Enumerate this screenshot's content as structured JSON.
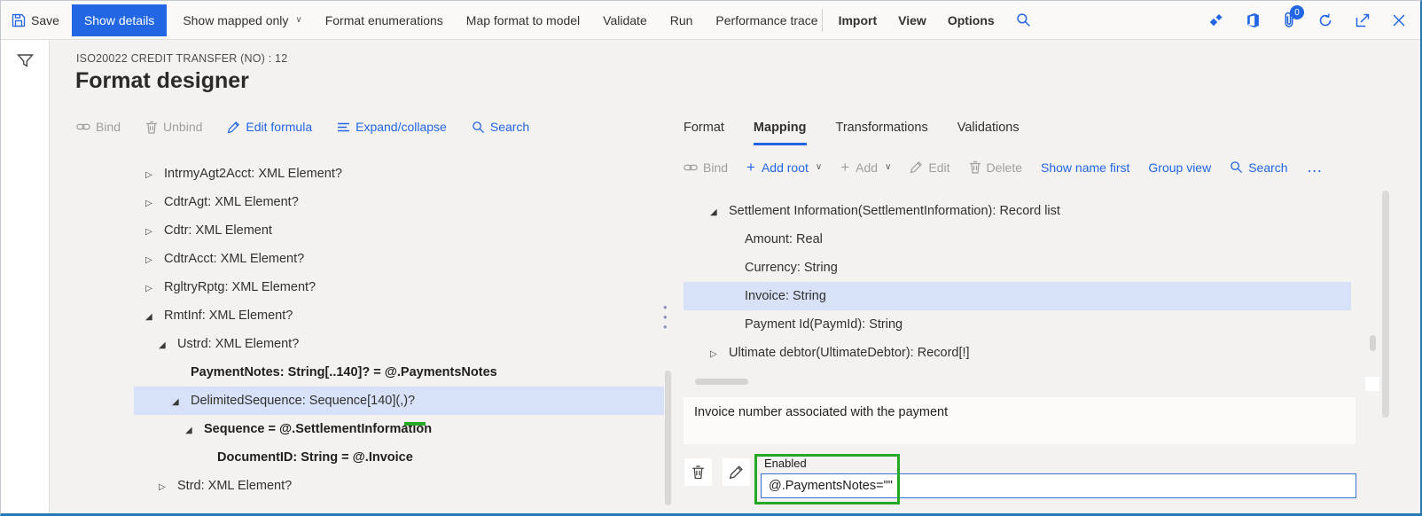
{
  "topbar": {
    "save": "Save",
    "show_details": "Show details",
    "show_mapped_only": "Show mapped only",
    "format_enumerations": "Format enumerations",
    "map_format_to_model": "Map format to model",
    "validate": "Validate",
    "run": "Run",
    "performance_trace": "Performance trace",
    "import": "Import",
    "view": "View",
    "options": "Options",
    "attachments_badge": "0"
  },
  "header": {
    "record_caption": "ISO20022 CREDIT TRANSFER (NO) : 12",
    "page_title": "Format designer"
  },
  "left_panel": {
    "toolbar": {
      "bind": "Bind",
      "unbind": "Unbind",
      "edit_formula": "Edit formula",
      "expand_collapse": "Expand/collapse",
      "search": "Search"
    },
    "tree": [
      {
        "label": "IntrmyAgt2Acct: XML Element?",
        "indent": 0,
        "arrow": "collapsed"
      },
      {
        "label": "CdtrAgt: XML Element?",
        "indent": 0,
        "arrow": "collapsed"
      },
      {
        "label": "Cdtr: XML Element",
        "indent": 0,
        "arrow": "collapsed"
      },
      {
        "label": "CdtrAcct: XML Element?",
        "indent": 0,
        "arrow": "collapsed"
      },
      {
        "label": "RgltryRptg: XML Element?",
        "indent": 0,
        "arrow": "collapsed"
      },
      {
        "label": "RmtInf: XML Element?",
        "indent": 0,
        "arrow": "expanded"
      },
      {
        "label": "Ustrd: XML Element?",
        "indent": 1,
        "arrow": "expanded"
      },
      {
        "label": "PaymentNotes: String[..140]? = @.PaymentsNotes",
        "indent": 2,
        "bold": true
      },
      {
        "label": "DelimitedSequence: Sequence[140](,)?",
        "indent": 2,
        "arrow": "expanded",
        "selected": true
      },
      {
        "label": "Sequence = @.SettlementInformation",
        "indent": 3,
        "arrow": "expanded",
        "bold": true
      },
      {
        "label": "DocumentID: String = @.Invoice",
        "indent": 4,
        "bold": true
      },
      {
        "label": "Strd: XML Element?",
        "indent": 1,
        "arrow": "collapsed"
      }
    ]
  },
  "right_panel": {
    "tabs": [
      {
        "label": "Format"
      },
      {
        "label": "Mapping",
        "active": true
      },
      {
        "label": "Transformations"
      },
      {
        "label": "Validations"
      }
    ],
    "toolbar": {
      "bind": "Bind",
      "add_root": "Add root",
      "add": "Add",
      "edit": "Edit",
      "delete": "Delete",
      "show_name_first": "Show name first",
      "group_view": "Group view",
      "search": "Search",
      "more": "…"
    },
    "tree": [
      {
        "label": "Settlement Information(SettlementInformation): Record list",
        "indent": 0,
        "arrow": "expanded"
      },
      {
        "label": "Amount: Real",
        "indent": 1
      },
      {
        "label": "Currency: String",
        "indent": 1
      },
      {
        "label": "Invoice: String",
        "indent": 1,
        "selected": true
      },
      {
        "label": "Payment Id(PaymId): String",
        "indent": 1
      },
      {
        "label": "Ultimate debtor(UltimateDebtor): Record[!]",
        "indent": 0,
        "arrow": "collapsed"
      }
    ],
    "description": "Invoice number associated with the payment",
    "formula": {
      "label": "Enabled",
      "value": "@.PaymentsNotes=\"\""
    }
  },
  "colors": {
    "accent": "#2266e3",
    "selection": "#d7e2f9",
    "enabled_green": "#25a825",
    "frame_blue": "#2779b4"
  }
}
